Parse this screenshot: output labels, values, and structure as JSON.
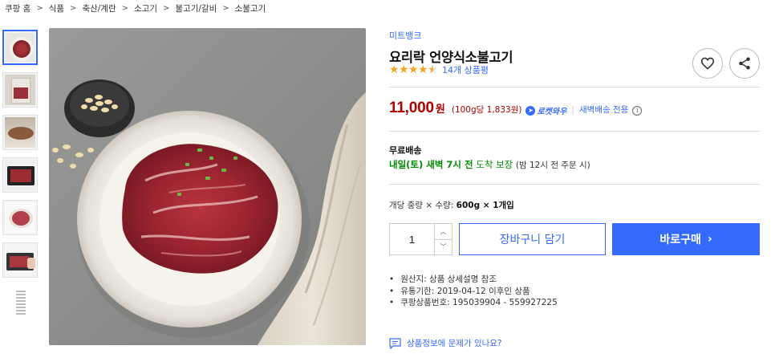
{
  "breadcrumb": [
    "쿠팡 홈",
    "식품",
    "축산/계란",
    "소고기",
    "불고기/갈비",
    "소불고기"
  ],
  "product": {
    "brand": "미트뱅크",
    "title": "요리락 언양식소불고기",
    "rating": 4.5,
    "review_count": "14개 상품평"
  },
  "price": {
    "amount": "11,000",
    "currency": "원",
    "unit_price": "(100g당 1,833원)",
    "rocket_label": "로켓와우",
    "dawn_delivery": "새벽배송 전용",
    "info_icon": "i"
  },
  "shipping": {
    "title": "무료배송",
    "date": "내일(토) 새벽 7시 전",
    "guarantee": "도착 보장",
    "note": "(밤 12시 전 주문 시)"
  },
  "option": {
    "label": "개당 중량 × 수량:",
    "value": "600g × 1개입"
  },
  "quantity": {
    "value": "1"
  },
  "buttons": {
    "cart": "장바구니 담기",
    "buy": "바로구매",
    "buy_arrow": "›"
  },
  "details": [
    "원산지: 상품 상세설명 참조",
    "유통기한: 2019-04-12 이후인 상품",
    "쿠팡상품번호: 195039904 - 559927225"
  ],
  "report_link": "상품정보에 문제가 있나요?",
  "icons": {
    "wish": "heart-icon",
    "share": "share-icon",
    "report": "comment-icon"
  },
  "colors": {
    "accent": "#346aff",
    "price": "#ae0000",
    "delivery": "#008c00",
    "star": "#f5a623"
  }
}
